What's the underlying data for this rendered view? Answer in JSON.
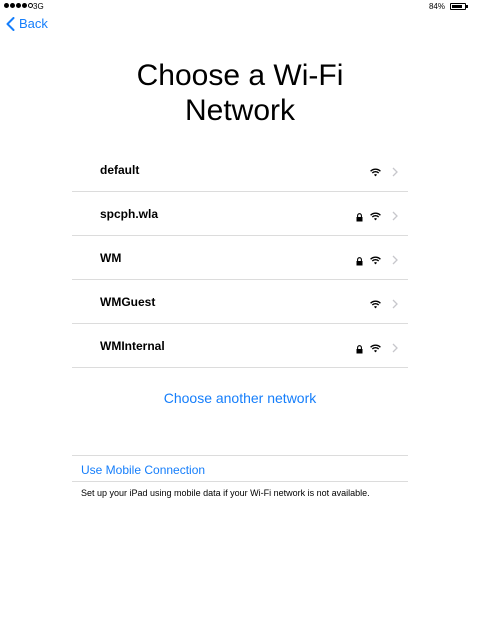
{
  "status_bar": {
    "carrier": "3G",
    "signal_bars_filled": 4,
    "signal_bars_total": 5,
    "battery_percent_text": "84%",
    "battery_level": 0.84
  },
  "nav": {
    "back_label": "Back",
    "back_icon": "chevron-left-icon"
  },
  "title": {
    "line1": "Choose a Wi-Fi",
    "line2": "Network"
  },
  "networks": [
    {
      "name": "default",
      "secured": false
    },
    {
      "name": "spcph.wla",
      "secured": true
    },
    {
      "name": "WM",
      "secured": true
    },
    {
      "name": "WMGuest",
      "secured": false
    },
    {
      "name": "WMInternal",
      "secured": true
    }
  ],
  "choose_another_label": "Choose another network",
  "mobile": {
    "link_label": "Use Mobile Connection",
    "description": "Set up your iPad using mobile data if your Wi-Fi network is not available."
  },
  "colors": {
    "accent": "#157efb",
    "separator": "#dcdcdc",
    "chevron": "#c7c7cc"
  }
}
